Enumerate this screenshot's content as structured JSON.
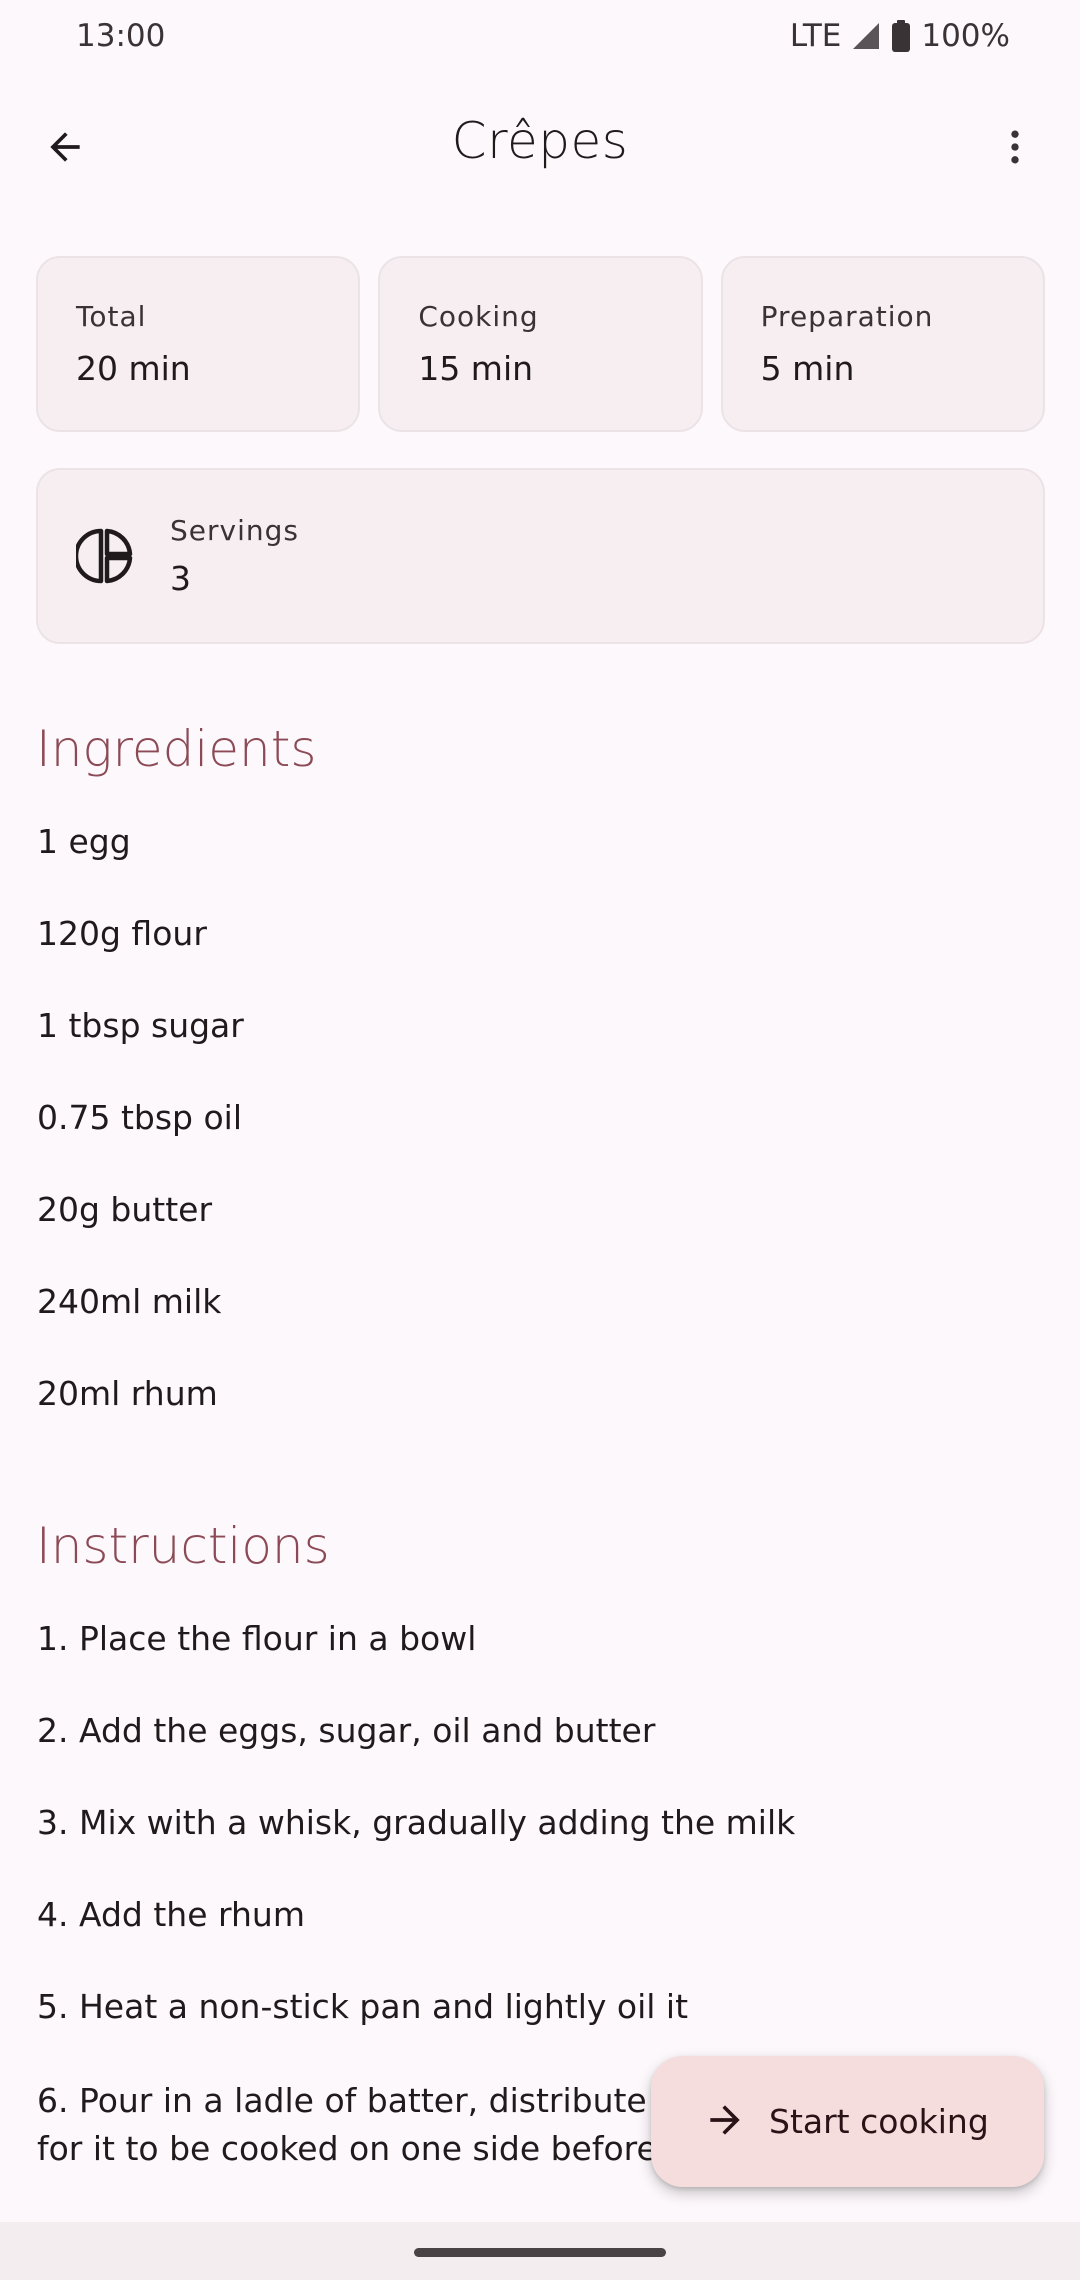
{
  "status_bar": {
    "time": "13:00",
    "network": "LTE",
    "battery": "100%"
  },
  "header": {
    "title": "Crêpes"
  },
  "times": [
    {
      "label": "Total",
      "value": "20 min"
    },
    {
      "label": "Cooking",
      "value": "15 min"
    },
    {
      "label": "Preparation",
      "value": "5 min"
    }
  ],
  "servings": {
    "label": "Servings",
    "value": "3"
  },
  "ingredients": {
    "title": "Ingredients",
    "items": [
      "1 egg",
      "120g flour",
      "1 tbsp sugar",
      "0.75 tbsp oil",
      "20g butter",
      "240ml milk",
      "20ml rhum"
    ]
  },
  "instructions": {
    "title": "Instructions",
    "steps": [
      "1. Place the flour in a bowl",
      "2. Add the eggs, sugar, oil and butter",
      "3. Mix with a whisk, gradually adding the milk",
      "4. Add the rhum",
      "5. Heat a non-stick pan and lightly oil it",
      "6. Pour in a ladle of batter, distribute",
      "for it to be cooked on one side before"
    ]
  },
  "fab": {
    "label": "Start cooking"
  },
  "colors": {
    "accent": "#8B4A56",
    "background": "#FDF8FB",
    "card": "#F6EEF1",
    "fab": "#F5DDDE"
  }
}
